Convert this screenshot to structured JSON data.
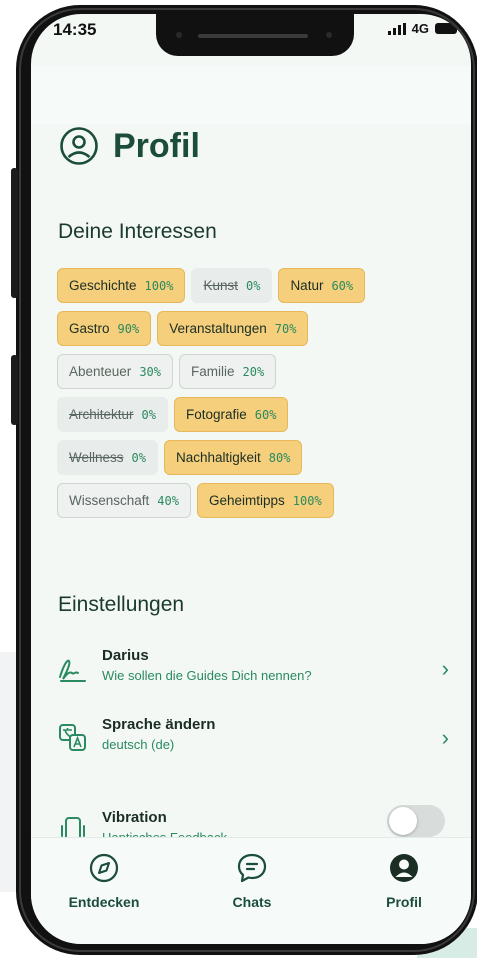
{
  "status": {
    "time": "14:35",
    "network": "4G"
  },
  "page_title": "Profil",
  "interests_section": {
    "heading": "Deine Interessen",
    "rows": [
      [
        {
          "name": "Geschichte",
          "percent": "100%",
          "state": "on"
        },
        {
          "name": "Kunst",
          "percent": "0%",
          "state": "off"
        },
        {
          "name": "Natur",
          "percent": "60%",
          "state": "on"
        }
      ],
      [
        {
          "name": "Gastro",
          "percent": "90%",
          "state": "on"
        },
        {
          "name": "Veranstaltungen",
          "percent": "70%",
          "state": "on"
        }
      ],
      [
        {
          "name": "Abenteuer",
          "percent": "30%",
          "state": "mid"
        },
        {
          "name": "Familie",
          "percent": "20%",
          "state": "mid"
        }
      ],
      [
        {
          "name": "Architektur",
          "percent": "0%",
          "state": "off"
        },
        {
          "name": "Fotografie",
          "percent": "60%",
          "state": "on"
        }
      ],
      [
        {
          "name": "Wellness",
          "percent": "0%",
          "state": "off"
        },
        {
          "name": "Nachhaltigkeit",
          "percent": "80%",
          "state": "on"
        }
      ],
      [
        {
          "name": "Wissenschaft",
          "percent": "40%",
          "state": "mid"
        },
        {
          "name": "Geheimtipps",
          "percent": "100%",
          "state": "on"
        }
      ]
    ]
  },
  "settings_section": {
    "heading": "Einstellungen",
    "name_setting": {
      "label": "Darius",
      "sub": "Wie sollen die Guides Dich nennen?",
      "icon": "signature-icon"
    },
    "language_setting": {
      "label": "Sprache ändern",
      "sub": "deutsch (de)",
      "icon": "translate-icon"
    },
    "vibration_setting": {
      "label": "Vibration",
      "sub": "Haptisches Feedback",
      "icon": "phone-vibrate-icon",
      "enabled": false
    }
  },
  "bottom_nav": {
    "explore": "Entdecken",
    "chats": "Chats",
    "profile": "Profil",
    "active": "profile"
  },
  "colors": {
    "accent": "#1b4d3a",
    "chip_active": "#f5cf7c",
    "percent_green": "#2a8a60",
    "background": "#f3f8f5"
  }
}
